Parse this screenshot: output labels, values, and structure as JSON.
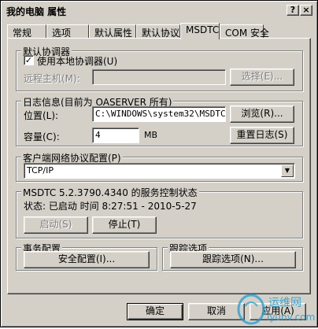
{
  "window": {
    "title": "我的电脑 属性",
    "help_glyph": "?",
    "close_glyph": "×"
  },
  "tabs": [
    {
      "label": "常规"
    },
    {
      "label": "选项"
    },
    {
      "label": "默认属性"
    },
    {
      "label": "默认协议"
    },
    {
      "label": "MSDTC"
    },
    {
      "label": "COM 安全"
    }
  ],
  "default_coordinator": {
    "group_label": "默认协调器",
    "use_local_checkbox_label": "使用本地协调器(U)",
    "use_local_checked": true,
    "check_glyph": "✓",
    "remote_host_label": "远程主机(M):",
    "remote_host_value": "",
    "select_button": "选择(E)..."
  },
  "log": {
    "group_label": "日志信息(目前为 OASERVER 所有)",
    "location_label": "位置(L):",
    "location_value": "C:\\WINDOWS\\system32\\MSDTC",
    "browse_button": "浏览(R)...",
    "capacity_label": "容量(C):",
    "capacity_value": "4",
    "capacity_unit": "MB",
    "reset_button": "重置日志(S)"
  },
  "client_network": {
    "group_label": "客户端网络协议配置(P)",
    "selected": "TCP/IP",
    "arrow_glyph": "▼"
  },
  "service_status": {
    "group_label": "MSDTC 5.2.3790.4340 的服务控制状态",
    "status_text": "状态: 已启动 时间 8:27:51 - 2010-5-27",
    "start_button": "启动(S)",
    "stop_button": "停止(T)"
  },
  "transaction": {
    "group_label": "事务配置",
    "security_button": "安全配置(I)..."
  },
  "tracing": {
    "group_label": "跟踪选项",
    "tracing_button": "跟踪选项(N)..."
  },
  "footer": {
    "ok_button": "确定",
    "cancel_button": "取消",
    "apply_button": "应用(A)"
  },
  "watermark": {
    "text_top": "运维网",
    "text_bottom": "iyunv.com",
    "color": "#1a9fd9"
  }
}
